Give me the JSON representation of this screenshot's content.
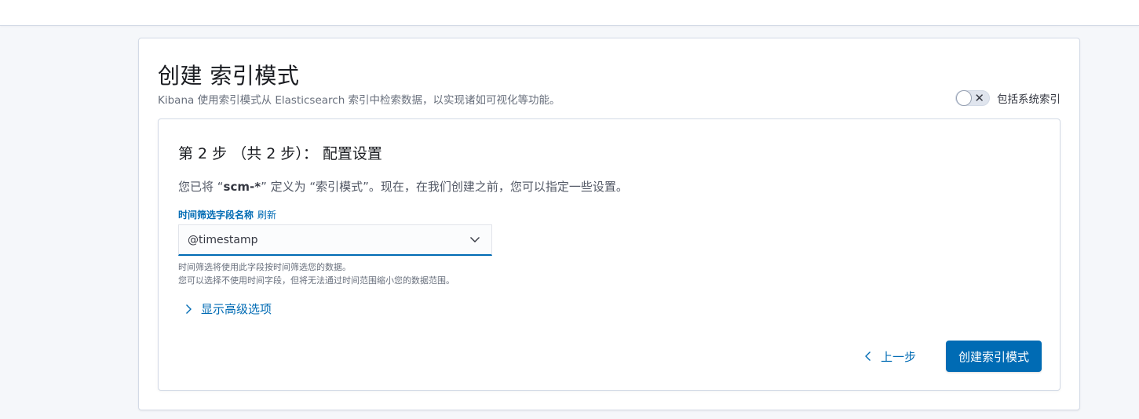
{
  "header": {
    "title": "创建 索引模式",
    "subtitle": "Kibana 使用索引模式从 Elasticsearch 索引中检索数据，以实现诸如可视化等功能。",
    "include_system_label": "包括系统索引",
    "include_system_enabled": false
  },
  "step": {
    "title": "第 2 步 （共 2 步）： 配置设置",
    "desc_prefix": "您已将 “",
    "pattern": "scm-*",
    "desc_suffix": "” 定义为 “索引模式”。现在，在我们创建之前，您可以指定一些设置。",
    "field_label": "时间筛选字段名称",
    "refresh_label": "刷新",
    "select_value": "@timestamp",
    "help_line1": "时间筛选将使用此字段按时间筛选您的数据。",
    "help_line2": "您可以选择不使用时间字段，但将无法通过时间范围缩小您的数据范围。",
    "advanced_label": "显示高级选项",
    "back_label": "上一步",
    "create_label": "创建索引模式"
  },
  "icons": {
    "toggle": "cross-icon",
    "select": "chevron-down-icon",
    "advanced": "chevron-right-icon",
    "back": "chevron-left-icon"
  },
  "colors": {
    "accent": "#006bb4",
    "background": "#f5f7fa"
  }
}
